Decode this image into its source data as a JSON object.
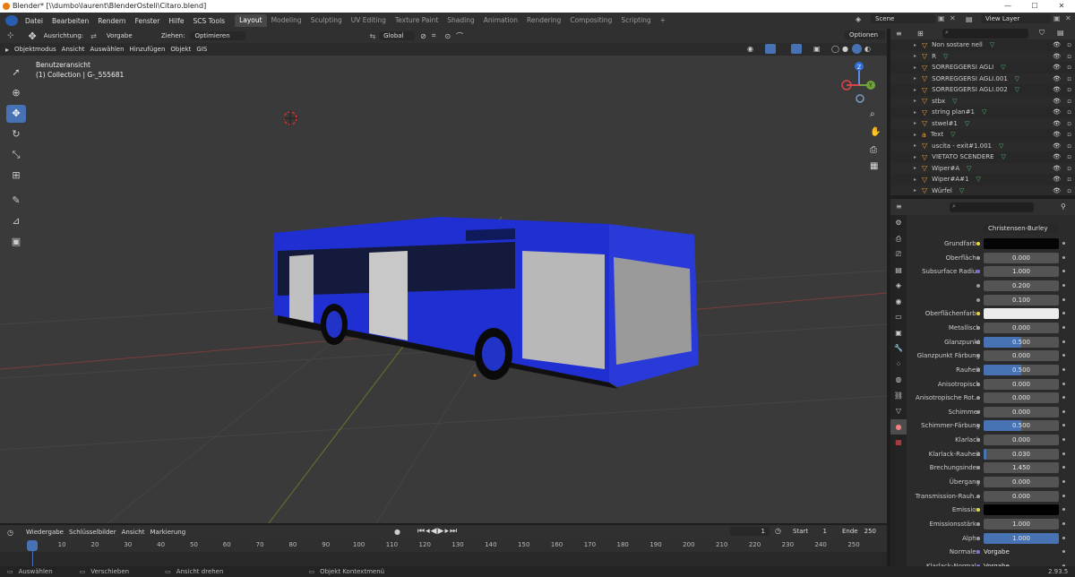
{
  "window": {
    "title": "Blender* [\\\\dumbo\\laurent\\BlenderOsteli\\Citaro.blend]",
    "minimize": "—",
    "maximize": "☐",
    "close": "✕"
  },
  "menu": {
    "items": [
      "Datei",
      "Bearbeiten",
      "Rendern",
      "Fenster",
      "Hilfe",
      "SCS Tools"
    ]
  },
  "workspaces": [
    "Layout",
    "Modeling",
    "Sculpting",
    "UV Editing",
    "Texture Paint",
    "Shading",
    "Animation",
    "Rendering",
    "Compositing",
    "Scripting",
    "+"
  ],
  "active_workspace": "Layout",
  "scene": {
    "name": "Scene",
    "view_layer": "View Layer"
  },
  "viewport_header": {
    "orientation_label": "Ausrichtung:",
    "orientation_value": "Vorgabe",
    "drag_label": "Ziehen:",
    "drag_value": "Optimieren",
    "transform_space": "Global",
    "options": "Optionen"
  },
  "viewport_menu": [
    "Objektmodus",
    "Ansicht",
    "Auswählen",
    "Hinzufügen",
    "Objekt",
    "GIS"
  ],
  "viewport_overlay": {
    "view_name": "Benutzeransicht",
    "collection": "(1) Collection | G-_555681"
  },
  "gizmo": {
    "x": "X",
    "y": "Y",
    "z": "Z"
  },
  "outliner": {
    "search_placeholder": "",
    "items": [
      {
        "name": "Non sostare nell",
        "icon": "▽"
      },
      {
        "name": "R",
        "icon": "▽"
      },
      {
        "name": "SORREGGERSI AGLI",
        "icon": "▽"
      },
      {
        "name": "SORREGGERSI AGLI.001",
        "icon": "▽"
      },
      {
        "name": "SORREGGERSI AGLI.002",
        "icon": "▽"
      },
      {
        "name": "stbx",
        "icon": "▽"
      },
      {
        "name": "string plan#1",
        "icon": "▽"
      },
      {
        "name": "stwel#1",
        "icon": "▽"
      },
      {
        "name": "Text",
        "icon": "a"
      },
      {
        "name": "uscita - exit#1.001",
        "icon": "▽"
      },
      {
        "name": "VIETATO SCENDERE",
        "icon": "▽"
      },
      {
        "name": "Wiper#A",
        "icon": "▽"
      },
      {
        "name": "Wiper#A#1",
        "icon": "▽"
      },
      {
        "name": "Würfel",
        "icon": "▽"
      }
    ]
  },
  "properties": {
    "search_placeholder": "",
    "subsurface_method": "Christensen-Burley",
    "rows": [
      {
        "label": "Grundfarbe",
        "type": "color",
        "color": "#050505"
      },
      {
        "label": "Oberfläche",
        "value": "0.000",
        "fill": 0
      },
      {
        "label": "Subsurface Radius",
        "value": "1.000",
        "fill": 0,
        "dot": "#7a6fd8"
      },
      {
        "label": "",
        "value": "0.200",
        "fill": 0
      },
      {
        "label": "",
        "value": "0.100",
        "fill": 0
      },
      {
        "label": "Oberflächenfarbe",
        "type": "color",
        "color": "#ececec"
      },
      {
        "label": "Metallisch",
        "value": "0.000",
        "fill": 0
      },
      {
        "label": "Glanzpunkt",
        "value": "0.500",
        "fill": 0.5
      },
      {
        "label": "Glanzpunkt Färbung",
        "value": "0.000",
        "fill": 0
      },
      {
        "label": "Rauheit",
        "value": "0.500",
        "fill": 0.5
      },
      {
        "label": "Anisotropisch",
        "value": "0.000",
        "fill": 0
      },
      {
        "label": "Anisotropische Rot...",
        "value": "0.000",
        "fill": 0
      },
      {
        "label": "Schimmer",
        "value": "0.000",
        "fill": 0
      },
      {
        "label": "Schimmer-Färbung",
        "value": "0.500",
        "fill": 0.5
      },
      {
        "label": "Klarlack",
        "value": "0.000",
        "fill": 0
      },
      {
        "label": "Klarlack-Rauheit",
        "value": "0.030",
        "fill": 0.03
      },
      {
        "label": "Brechungsindex",
        "value": "1.450",
        "fill": 0
      },
      {
        "label": "Übergang",
        "value": "0.000",
        "fill": 0
      },
      {
        "label": "Transmission-Rauh...",
        "value": "0.000",
        "fill": 0
      },
      {
        "label": "Emission",
        "type": "color",
        "color": "#000000"
      },
      {
        "label": "Emissionsstärke",
        "value": "1.000",
        "fill": 0
      },
      {
        "label": "Alpha",
        "value": "1.000",
        "fill": 1
      },
      {
        "label": "Normalen",
        "type": "text",
        "value": "Vorgabe",
        "dot": "#7a6fd8"
      },
      {
        "label": "Klarlack-Normale",
        "type": "text",
        "value": "Vorgabe",
        "dot": "#7a6fd8"
      }
    ]
  },
  "timeline": {
    "menu": [
      "Wiedergabe",
      "Schlüsselbilder",
      "Ansicht",
      "Markierung"
    ],
    "current_frame": "1",
    "start_label": "Start",
    "start": "1",
    "end_label": "Ende",
    "end": "250",
    "ruler": [
      "1",
      "10",
      "20",
      "30",
      "40",
      "50",
      "60",
      "70",
      "80",
      "90",
      "100",
      "110",
      "120",
      "130",
      "140",
      "150",
      "160",
      "170",
      "180",
      "190",
      "200",
      "210",
      "220",
      "230",
      "240",
      "250"
    ]
  },
  "status": {
    "select": "Auswählen",
    "move": "Verschieben",
    "rotate": "Ansicht drehen",
    "context": "Objekt Kontextmenü",
    "version": "2.93.5"
  },
  "colors": {
    "accent": "#4772b3",
    "bus": "#1f2fd1",
    "grid_x": "#7a3c3c",
    "grid_y": "#5e7a2e"
  }
}
